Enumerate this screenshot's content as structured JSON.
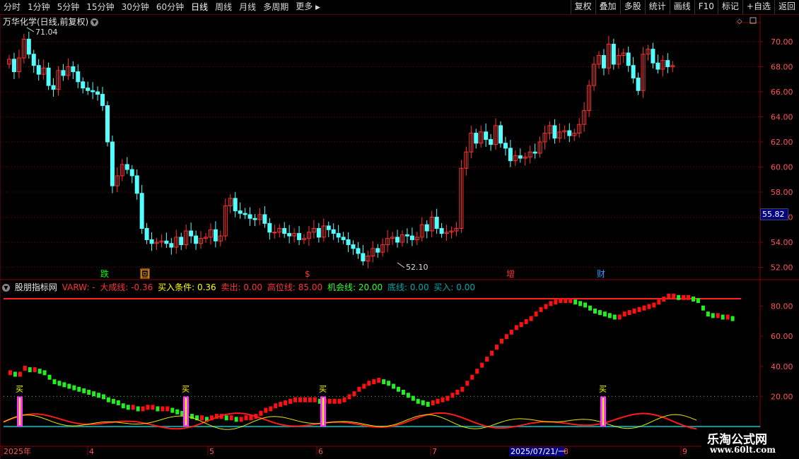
{
  "toolbar": {
    "periods": [
      "分时",
      "1分钟",
      "5分钟",
      "15分钟",
      "30分钟",
      "60分钟",
      "日线",
      "周线",
      "月线",
      "多周期",
      "更多"
    ],
    "more_arrow": "▶",
    "right_buttons": [
      "复权",
      "叠加",
      "多股",
      "统计",
      "画线",
      "F10",
      "+自选",
      "返回"
    ],
    "right_extra": "标记"
  },
  "stock": {
    "title": "万华化学(日线,前复权)",
    "high_label": "71.04",
    "low_label": "52.10",
    "current_price": "55.82"
  },
  "price_axis": [
    "70.00",
    "68.00",
    "66.00",
    "64.00",
    "62.00",
    "60.00",
    "58.00",
    "56.00",
    "54.00",
    "52.00"
  ],
  "events": [
    {
      "label": "跌",
      "color": "#00ff00"
    },
    {
      "label": "回",
      "color": "#ffa500"
    },
    {
      "label": "$",
      "color": "#ff3333"
    },
    {
      "label": "增",
      "color": "#ff3333"
    },
    {
      "label": "财",
      "color": "#3399ff"
    }
  ],
  "indicator": {
    "name": "股朋指标网",
    "items": [
      {
        "text": "VARW: -",
        "color": "#ff3333"
      },
      {
        "text": "大成线: -0.36",
        "color": "#ff3333"
      },
      {
        "text": "买入条件: 0.36",
        "color": "#ffff00"
      },
      {
        "text": "卖出: 0.00",
        "color": "#ff3333"
      },
      {
        "text": "高位线: 85.00",
        "color": "#ff3333"
      },
      {
        "text": "机会线: 20.00",
        "color": "#33ff33"
      },
      {
        "text": "底线: 0.00",
        "color": "#00aaaa"
      },
      {
        "text": "买入: 0.00",
        "color": "#00aaaa"
      }
    ],
    "axis": [
      "80.00",
      "60.00",
      "40.00",
      "20.00"
    ],
    "buy_label": "买"
  },
  "time_axis": [
    "2025年",
    "4",
    "5",
    "6",
    "7",
    "8",
    "9"
  ],
  "cursor_date": "2025/07/21/一",
  "watermark": {
    "line1": "乐淘公式网",
    "line2": "www.60lt.com"
  },
  "colors": {
    "up": "#ff3232",
    "down": "#54ffff",
    "bg": "#000000"
  }
}
